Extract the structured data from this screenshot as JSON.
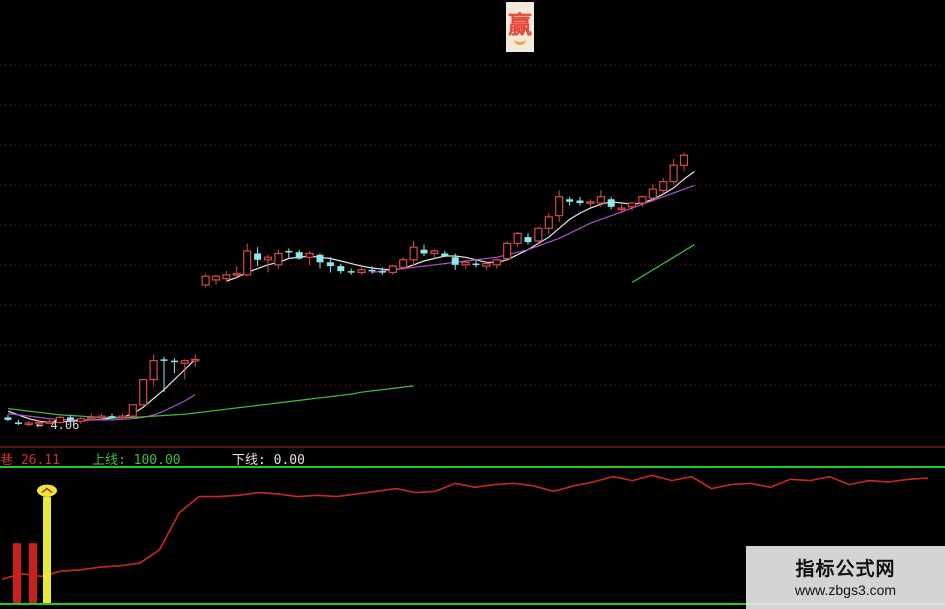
{
  "chart_data": [
    {
      "type": "candlestick",
      "panel": "main",
      "colors": {
        "up": "#d94a4a",
        "down": "#8ee8f0",
        "ma_short": "#e6e6e6",
        "ma_mid": "#a84fd0",
        "ma_long": "#3fbf3f",
        "grid": "#b22222"
      },
      "low_marker": "4.06",
      "candles": [
        [
          4.2,
          4.24,
          4.14,
          4.16
        ],
        [
          4.12,
          4.16,
          4.08,
          4.1
        ],
        [
          4.1,
          4.14,
          4.06,
          4.11
        ],
        [
          4.12,
          4.16,
          4.09,
          4.12
        ],
        [
          4.12,
          4.18,
          4.1,
          4.13
        ],
        [
          4.12,
          4.22,
          4.1,
          4.2
        ],
        [
          4.2,
          4.24,
          4.14,
          4.16
        ],
        [
          4.14,
          4.2,
          4.1,
          4.18
        ],
        [
          4.2,
          4.26,
          4.16,
          4.2
        ],
        [
          4.2,
          4.26,
          4.16,
          4.22
        ],
        [
          4.22,
          4.26,
          4.18,
          4.21
        ],
        [
          4.2,
          4.26,
          4.16,
          4.22
        ],
        [
          4.22,
          4.4,
          4.2,
          4.4
        ],
        [
          4.4,
          4.8,
          4.38,
          4.8
        ],
        [
          4.8,
          5.2,
          4.7,
          5.1
        ],
        [
          5.12,
          5.16,
          4.6,
          5.1
        ],
        [
          5.1,
          5.14,
          4.9,
          5.08
        ],
        [
          5.06,
          5.12,
          4.8,
          5.1
        ],
        [
          5.1,
          5.2,
          5.0,
          5.12
        ],
        [
          6.3,
          6.48,
          6.26,
          6.44
        ],
        [
          6.38,
          6.46,
          6.3,
          6.44
        ],
        [
          6.4,
          6.52,
          6.36,
          6.46
        ],
        [
          6.46,
          6.6,
          6.4,
          6.48
        ],
        [
          6.46,
          6.96,
          6.44,
          6.84
        ],
        [
          6.8,
          6.9,
          6.6,
          6.7
        ],
        [
          6.7,
          6.78,
          6.5,
          6.74
        ],
        [
          6.62,
          6.86,
          6.56,
          6.8
        ],
        [
          6.84,
          6.88,
          6.72,
          6.82
        ],
        [
          6.82,
          6.86,
          6.7,
          6.72
        ],
        [
          6.74,
          6.84,
          6.62,
          6.8
        ],
        [
          6.78,
          6.8,
          6.56,
          6.66
        ],
        [
          6.66,
          6.74,
          6.5,
          6.6
        ],
        [
          6.6,
          6.64,
          6.48,
          6.52
        ],
        [
          6.52,
          6.56,
          6.46,
          6.5
        ],
        [
          6.5,
          6.58,
          6.46,
          6.54
        ],
        [
          6.54,
          6.6,
          6.48,
          6.52
        ],
        [
          6.52,
          6.58,
          6.46,
          6.5
        ],
        [
          6.5,
          6.62,
          6.46,
          6.6
        ],
        [
          6.58,
          6.74,
          6.54,
          6.7
        ],
        [
          6.7,
          7.0,
          6.6,
          6.9
        ],
        [
          6.86,
          6.94,
          6.76,
          6.8
        ],
        [
          6.8,
          6.86,
          6.72,
          6.84
        ],
        [
          6.8,
          6.84,
          6.74,
          6.76
        ],
        [
          6.74,
          6.8,
          6.54,
          6.62
        ],
        [
          6.62,
          6.7,
          6.56,
          6.66
        ],
        [
          6.64,
          6.7,
          6.58,
          6.62
        ],
        [
          6.6,
          6.68,
          6.54,
          6.64
        ],
        [
          6.62,
          6.72,
          6.56,
          6.7
        ],
        [
          6.72,
          7.0,
          6.68,
          6.96
        ],
        [
          6.96,
          7.14,
          6.9,
          7.12
        ],
        [
          7.06,
          7.12,
          6.94,
          6.98
        ],
        [
          7.0,
          7.22,
          6.96,
          7.2
        ],
        [
          7.2,
          7.44,
          7.1,
          7.38
        ],
        [
          7.4,
          7.8,
          7.3,
          7.7
        ],
        [
          7.66,
          7.7,
          7.56,
          7.62
        ],
        [
          7.64,
          7.7,
          7.56,
          7.6
        ],
        [
          7.6,
          7.66,
          7.54,
          7.62
        ],
        [
          7.6,
          7.8,
          7.54,
          7.7
        ],
        [
          7.66,
          7.7,
          7.5,
          7.54
        ],
        [
          7.5,
          7.58,
          7.44,
          7.52
        ],
        [
          7.54,
          7.62,
          7.48,
          7.6
        ],
        [
          7.6,
          7.72,
          7.54,
          7.7
        ],
        [
          7.68,
          7.9,
          7.62,
          7.82
        ],
        [
          7.8,
          8.0,
          7.74,
          7.94
        ],
        [
          7.94,
          8.3,
          7.88,
          8.2
        ],
        [
          8.2,
          8.4,
          8.1,
          8.36
        ]
      ],
      "ma": [
        {
          "color": "#e6e6e6",
          "values": [
            4.3,
            4.24,
            4.18,
            4.14,
            4.12,
            4.13,
            4.14,
            4.15,
            4.16,
            4.17,
            4.19,
            4.2,
            4.26,
            4.36,
            4.5,
            4.64,
            4.8,
            4.96,
            5.12,
            null,
            null,
            6.36,
            6.42,
            6.5,
            6.56,
            6.62,
            6.66,
            6.72,
            6.74,
            6.76,
            6.74,
            6.72,
            6.68,
            6.64,
            6.6,
            6.57,
            6.55,
            6.54,
            6.56,
            6.62,
            6.68,
            6.72,
            6.76,
            6.76,
            6.74,
            6.7,
            6.66,
            6.66,
            6.7,
            6.78,
            6.86,
            6.96,
            7.06,
            7.2,
            7.34,
            7.44,
            7.52,
            7.58,
            7.62,
            7.6,
            7.58,
            7.6,
            7.66,
            7.74,
            7.84,
            7.98,
            8.1
          ]
        },
        {
          "color": "#a84fd0",
          "values": [
            4.26,
            4.24,
            4.22,
            4.2,
            4.18,
            4.17,
            4.16,
            4.16,
            4.16,
            4.16,
            4.16,
            4.17,
            4.18,
            4.2,
            4.24,
            4.3,
            4.38,
            4.46,
            4.56,
            null,
            null,
            null,
            null,
            null,
            null,
            null,
            null,
            null,
            null,
            null,
            null,
            null,
            null,
            null,
            null,
            6.5,
            6.52,
            6.54,
            6.56,
            6.58,
            6.6,
            6.62,
            6.64,
            6.66,
            6.68,
            6.7,
            6.72,
            6.74,
            6.78,
            6.82,
            6.86,
            6.92,
            6.98,
            7.04,
            7.12,
            7.2,
            7.28,
            7.34,
            7.4,
            7.46,
            7.52,
            7.58,
            7.64,
            7.7,
            7.76,
            7.82,
            7.88
          ]
        },
        {
          "color": "#3fbf3f",
          "values": [
            4.34,
            4.32,
            4.3,
            4.28,
            4.26,
            4.24,
            4.23,
            4.22,
            4.21,
            4.2,
            4.2,
            4.2,
            4.2,
            4.21,
            4.22,
            4.23,
            4.24,
            4.25,
            4.27,
            4.29,
            4.31,
            4.33,
            4.35,
            4.37,
            4.39,
            4.41,
            4.43,
            4.45,
            4.47,
            4.49,
            4.51,
            4.53,
            4.55,
            4.57,
            4.6,
            4.62,
            4.64,
            4.66,
            4.68,
            4.7,
            null,
            null,
            null,
            null,
            null,
            null,
            null,
            null,
            null,
            null,
            null,
            null,
            null,
            null,
            null,
            null,
            null,
            null,
            null,
            null,
            6.34,
            6.44,
            6.54,
            6.64,
            6.74,
            6.84,
            6.94
          ]
        }
      ]
    },
    {
      "type": "line",
      "panel": "indicator",
      "label_value": "26.11",
      "upper_label": "上线: 100.00",
      "lower_label": "下线: 0.00",
      "label_colors": {
        "value": "#c83232",
        "upper": "#3fbf3f",
        "lower": "#e0e0e0"
      },
      "line_color": "#c82828",
      "boundary_color": "#22cc22",
      "ylim": [
        0,
        100
      ],
      "values": [
        18,
        22,
        20,
        24,
        25,
        27,
        28,
        30,
        40,
        68,
        80,
        80,
        81,
        83,
        82,
        80,
        81,
        80,
        82,
        84,
        86,
        83,
        84,
        90,
        87,
        89,
        90,
        88,
        84,
        88,
        91,
        95,
        92,
        96,
        92,
        95,
        86,
        89,
        90,
        87,
        93,
        92,
        95,
        89,
        92,
        91,
        93,
        94
      ],
      "signal_bars": [
        {
          "color": "#c81e1e",
          "value": 45
        },
        {
          "color": "#c81e1e",
          "value": 45
        },
        {
          "color": "#e8e83a",
          "value": 80
        }
      ]
    }
  ],
  "logo_char": "赢",
  "watermark": {
    "title": "指标公式网",
    "url": "www.zbgs3.com"
  }
}
